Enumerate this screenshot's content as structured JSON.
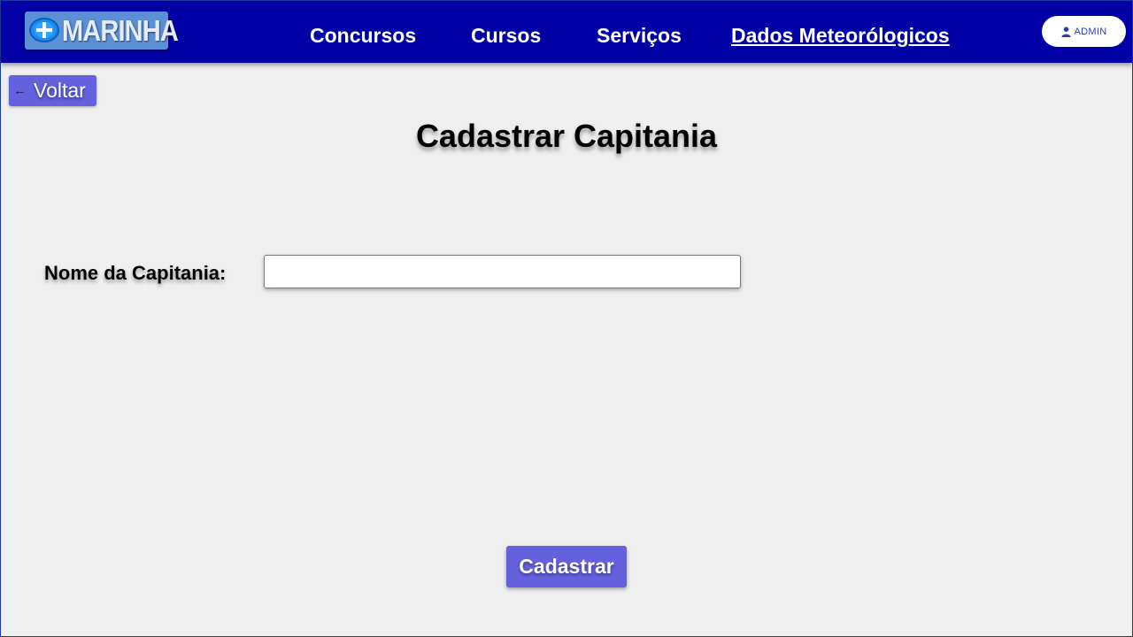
{
  "header": {
    "logo_text": "MARINHA",
    "nav": [
      {
        "label": "Concursos"
      },
      {
        "label": "Cursos"
      },
      {
        "label": "Serviços"
      },
      {
        "label": "Dados Meteorólogicos"
      }
    ],
    "user_button": {
      "label": "ADMIN",
      "icon": "user-icon"
    }
  },
  "back_button": {
    "label": "Voltar",
    "icon": "arrow-left-icon"
  },
  "page_title": "Cadastrar Capitania",
  "form": {
    "name_label": "Nome da Capitania:",
    "name_value": "",
    "submit_label": "Cadastrar"
  },
  "colors": {
    "navbar": "#0000a4",
    "accent_button": "#6460de",
    "background": "#efefef"
  }
}
